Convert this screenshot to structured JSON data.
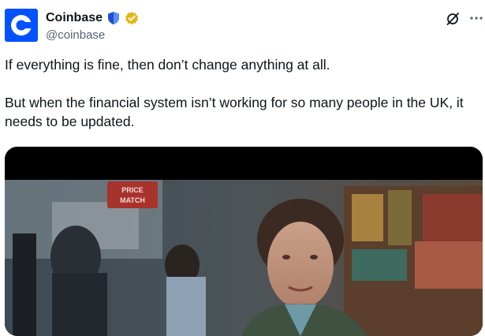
{
  "tweet": {
    "author": {
      "display_name": "Coinbase",
      "handle": "@coinbase",
      "avatar_icon": "coinbase-logo",
      "badges": [
        "shield-icon",
        "gold-verified-badge-icon"
      ]
    },
    "header_icons": [
      "grok-icon",
      "more-options-icon"
    ],
    "text_paragraphs": [
      "If everything is fine, then don’t change anything at all.",
      "But when the financial system isn’t working for so many people in the UK, it needs to be updated."
    ],
    "media": {
      "type": "video-still",
      "sign_text": "PRICE\nMATCH"
    },
    "colors": {
      "brand_blue": "#0052ff",
      "verified_gold": "#e2b719",
      "text_primary": "#0f1419",
      "text_secondary": "#536471"
    }
  }
}
